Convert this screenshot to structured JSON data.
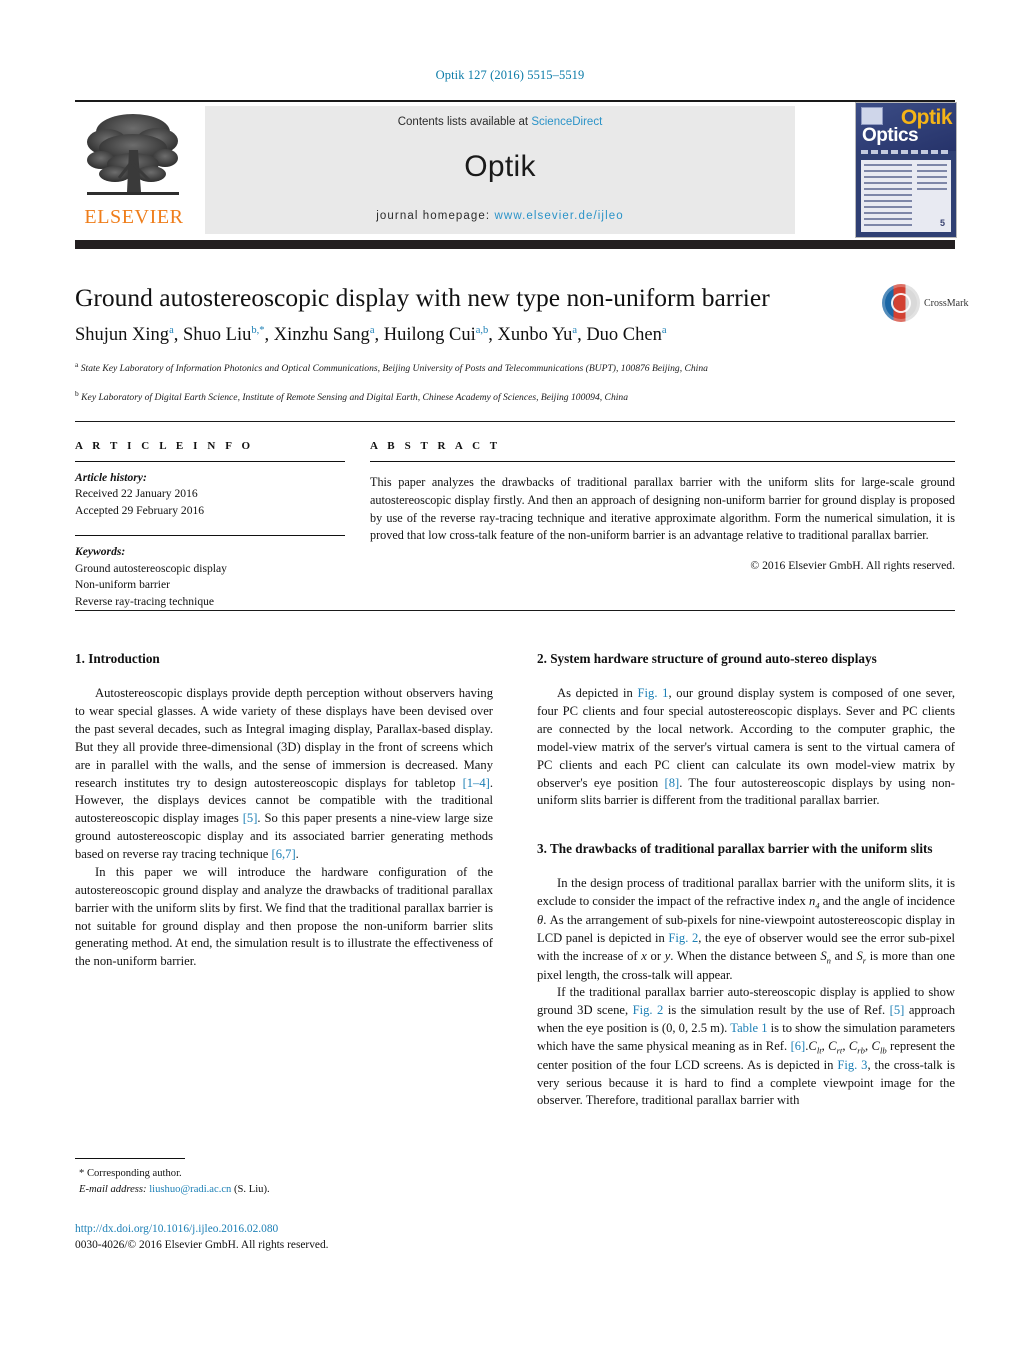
{
  "running_head": "Optik 127 (2016) 5515–5519",
  "masthead": {
    "contents_text": "Contents lists available at",
    "sciencedirect": "ScienceDirect",
    "journal_name": "Optik",
    "homepage_label": "journal homepage:",
    "homepage_url": "www.elsevier.de/ijleo",
    "publisher": "ELSEVIER",
    "cover": {
      "title_main": "Optik",
      "title_sub": "Optics",
      "issue_number": "5"
    },
    "link_color": "#2b93c8"
  },
  "article": {
    "title": "Ground autostereoscopic display with new type non-uniform barrier",
    "crossmark_label": "CrossMark",
    "authors_html": "Shujun Xing<sup>a</sup>, Shuo Liu<sup>b,*</sup>, Xinzhu Sang<sup>a</sup>, Huilong Cui<sup>a,b</sup>, Xunbo Yu<sup>a</sup>, Duo Chen<sup>a</sup>",
    "affiliation_a": "State Key Laboratory of Information Photonics and Optical Communications, Beijing University of Posts and Telecommunications (BUPT), 100876 Beijing, China",
    "affiliation_b": "Key Laboratory of Digital Earth Science, Institute of Remote Sensing and Digital Earth, Chinese Academy of Sciences, Beijing 100094, China"
  },
  "article_info": {
    "heading": "A R T I C L E   I N F O",
    "history_label": "Article history:",
    "received": "Received 22 January 2016",
    "accepted": "Accepted 29 February 2016",
    "keywords_label": "Keywords:",
    "keywords": [
      "Ground autostereoscopic display",
      "Non-uniform barrier",
      "Reverse ray-tracing technique"
    ]
  },
  "abstract": {
    "heading": "A B S T R A C T",
    "text": "This paper analyzes the drawbacks of traditional parallax barrier with the uniform slits for large-scale ground autostereoscopic display firstly. And then an approach of designing non-uniform barrier for ground display is proposed by use of the reverse ray-tracing technique and iterative approximate algorithm. Form the numerical simulation, it is proved that low cross-talk feature of the non-uniform barrier is an advantage relative to traditional parallax barrier.",
    "copyright": "© 2016 Elsevier GmbH. All rights reserved."
  },
  "sections": {
    "s1_heading": "1.  Introduction",
    "s1_p1_html": "Autostereoscopic displays provide depth perception without observers having to wear special glasses. A wide variety of these displays have been devised over the past several decades, such as Integral imaging display, Parallax-based display. But they all provide three-dimensional (3D) display in the front of screens which are in parallel with the walls, and the sense of immersion is decreased. Many research institutes try to design autostereoscopic displays for tabletop <span class=\"ref\">[1–4]</span>. However, the displays devices cannot be compatible with the traditional autostereoscopic display images <span class=\"ref\">[5]</span>. So this paper presents a nine-view large size ground autostereoscopic display and its associated barrier generating methods based on reverse ray tracing technique <span class=\"ref\">[6,7]</span>.",
    "s1_p2_html": "In this paper we will introduce the hardware configuration of the autostereoscopic ground display and analyze the drawbacks of traditional parallax barrier with the uniform slits by first. We find that the traditional parallax barrier is not suitable for ground display and then propose the non-uniform barrier slits generating method. At end, the simulation result is to illustrate the effectiveness of the non-uniform barrier.",
    "s2_heading": "2.  System hardware structure of ground auto-stereo displays",
    "s2_p1_html": "As depicted in <span class=\"ref\">Fig. 1</span>, our ground display system is composed of one sever, four PC clients and four special autostereoscopic displays. Sever and PC clients are connected by the local network. According to the computer graphic, the model-view matrix of the server's virtual camera is sent to the virtual camera of PC clients and each PC client can calculate its own model-view matrix by observer's eye position <span class=\"ref\">[8]</span>. The four autostereoscopic displays by using non-uniform slits barrier is different from the traditional parallax barrier.",
    "s3_heading": "3.  The drawbacks of traditional parallax barrier with the uniform slits",
    "s3_p1_html": "In the design process of traditional parallax barrier with the uniform slits, it is exclude to consider the impact of the refractive index <span class=\"ital\">n</span><span class=\"sub\">4</span> and the angle of incidence <span class=\"ital\">θ</span>. As the arrangement of sub-pixels for nine-viewpoint autostereoscopic display in LCD panel is depicted in <span class=\"ref\">Fig. 2</span>, the eye of observer would see the error sub-pixel with the increase of <span class=\"ital\">x</span> or <span class=\"ital\">y</span>. When the distance between <span class=\"ital\">S</span><span class=\"sub\">n</span> and <span class=\"ital\">S</span><span class=\"sub\">r</span> is more than one pixel length, the cross-talk will appear.",
    "s3_p2_html": "If the traditional parallax barrier auto-stereoscopic display is applied to show ground 3D scene, <span class=\"ref\">Fig. 2</span> is the simulation result by the use of Ref. <span class=\"ref\">[5]</span> approach when the eye position is (0, 0, 2.5 m). <span class=\"ref\">Table 1</span> is to show the simulation parameters which have the same physical meaning as in Ref. <span class=\"ref\">[6]</span>.<span class=\"ital\">C</span><span class=\"sub\">lt</span>, <span class=\"ital\">C</span><span class=\"sub\">rt</span>, <span class=\"ital\">C</span><span class=\"sub\">rb</span>, <span class=\"ital\">C</span><span class=\"sub\">lb</span> represent the center position of the four LCD screens. As is depicted in <span class=\"ref\">Fig. 3</span>, the cross-talk is very serious because it is hard to find a complete viewpoint image for the observer. Therefore, traditional parallax barrier with"
  },
  "footer": {
    "corresponding": "*  Corresponding author.",
    "email_label": "E-mail address:",
    "email": "liushuo@radi.ac.cn",
    "email_suffix": "(S. Liu).",
    "doi": "http://dx.doi.org/10.1016/j.ijleo.2016.02.080",
    "issn": "0030-4026/© 2016 Elsevier GmbH. All rights reserved."
  }
}
